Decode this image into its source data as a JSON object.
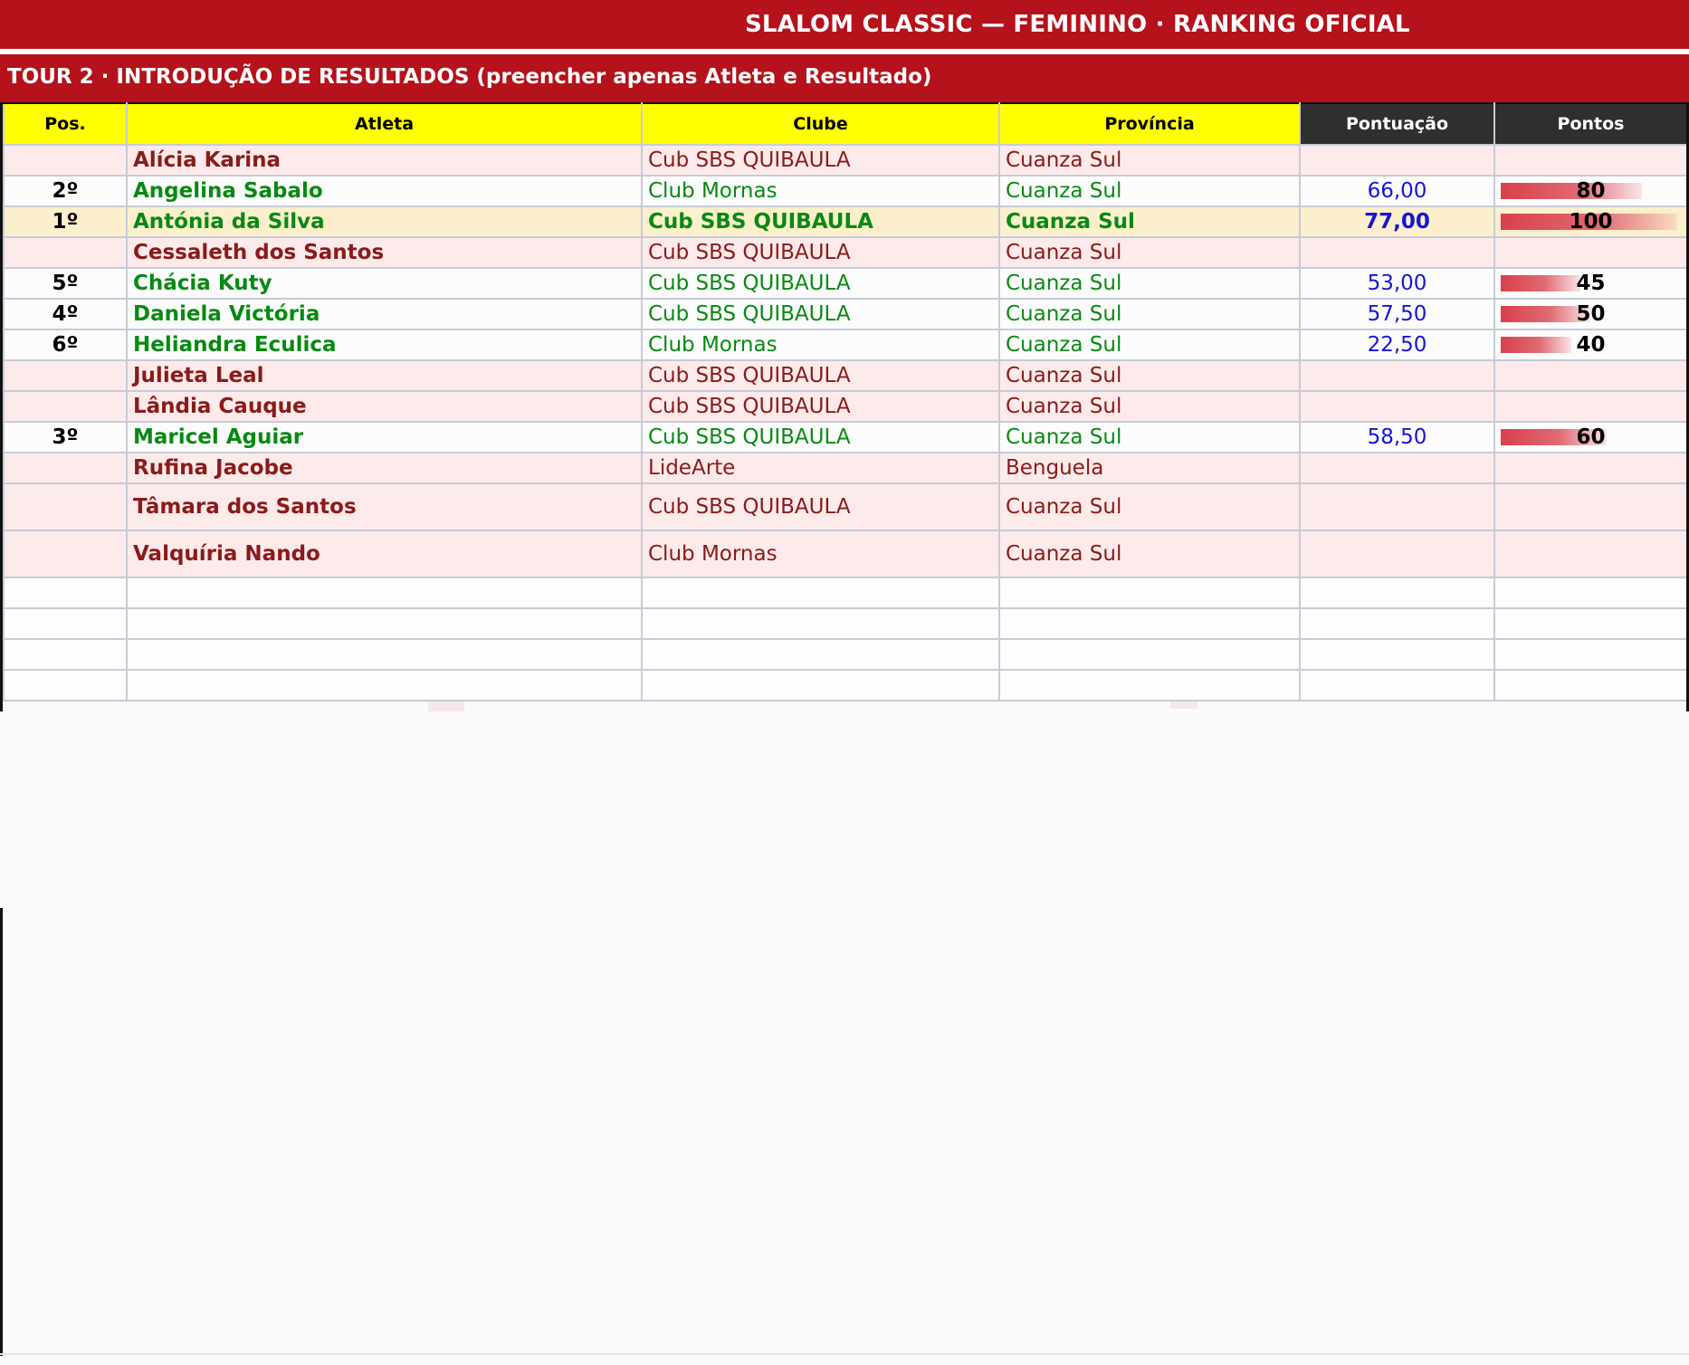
{
  "header": {
    "title": "SLALOM CLASSIC — FEMININO  ·  RANKING OFICIAL",
    "subtitle": "TOUR 2  ·  INTRODUÇÃO DE RESULTADOS  (preencher apenas Atleta e Resultado)"
  },
  "columns": {
    "pos": "Pos.",
    "athlete": "Atleta",
    "club": "Clube",
    "province": "Província",
    "score": "Pontuação",
    "points": "Pontos"
  },
  "colors": {
    "brand_red": "#b5121b",
    "header_yellow": "#ffff00",
    "header_dark": "#2f2f2f",
    "ranked_green": "#078a12",
    "pending_red": "#8b1a1a",
    "score_blue": "#1515d6"
  },
  "rows": [
    {
      "pos": "",
      "athlete": "Alícia Karina",
      "club": "Cub SBS QUIBAULA",
      "province": "Cuanza Sul",
      "score": "",
      "points": "",
      "bar": 0,
      "state": "pending"
    },
    {
      "pos": "2º",
      "athlete": "Angelina Sabalo",
      "club": "Club Mornas",
      "province": "Cuanza Sul",
      "score": "66,00",
      "points": "80",
      "bar": 0.8,
      "state": "ranked"
    },
    {
      "pos": "1º",
      "athlete": "Antónia da Silva",
      "club": "Cub SBS QUIBAULA",
      "province": "Cuanza Sul",
      "score": "77,00",
      "points": "100",
      "bar": 1.0,
      "state": "leader"
    },
    {
      "pos": "",
      "athlete": "Cessaleth dos Santos",
      "club": "Cub SBS QUIBAULA",
      "province": "Cuanza Sul",
      "score": "",
      "points": "",
      "bar": 0,
      "state": "pending"
    },
    {
      "pos": "5º",
      "athlete": "Chácia Kuty",
      "club": "Cub SBS QUIBAULA",
      "province": "Cuanza Sul",
      "score": "53,00",
      "points": "45",
      "bar": 0.45,
      "state": "ranked"
    },
    {
      "pos": "4º",
      "athlete": "Daniela Victória",
      "club": "Cub SBS QUIBAULA",
      "province": "Cuanza Sul",
      "score": "57,50",
      "points": "50",
      "bar": 0.5,
      "state": "ranked"
    },
    {
      "pos": "6º",
      "athlete": "Heliandra Eculica",
      "club": "Club Mornas",
      "province": "Cuanza Sul",
      "score": "22,50",
      "points": "40",
      "bar": 0.4,
      "state": "ranked"
    },
    {
      "pos": "",
      "athlete": "Julieta Leal",
      "club": "Cub SBS QUIBAULA",
      "province": "Cuanza Sul",
      "score": "",
      "points": "",
      "bar": 0,
      "state": "pending"
    },
    {
      "pos": "",
      "athlete": "Lândia Cauque",
      "club": "Cub SBS QUIBAULA",
      "province": "Cuanza Sul",
      "score": "",
      "points": "",
      "bar": 0,
      "state": "pending"
    },
    {
      "pos": "3º",
      "athlete": "Maricel Aguiar",
      "club": "Cub SBS QUIBAULA",
      "province": "Cuanza Sul",
      "score": "58,50",
      "points": "60",
      "bar": 0.6,
      "state": "ranked"
    },
    {
      "pos": "",
      "athlete": "Rufina Jacobe",
      "club": "LideArte",
      "province": "Benguela",
      "score": "",
      "points": "",
      "bar": 0,
      "state": "pending"
    },
    {
      "pos": "",
      "athlete": "Tâmara dos Santos",
      "club": "Cub SBS QUIBAULA",
      "province": "Cuanza Sul",
      "score": "",
      "points": "",
      "bar": 0,
      "state": "pending",
      "tall": true
    },
    {
      "pos": "",
      "athlete": "Valquíria Nando",
      "club": "Club Mornas",
      "province": "Cuanza Sul",
      "score": "",
      "points": "",
      "bar": 0,
      "state": "pending",
      "tall": true
    }
  ],
  "blank_rows": 4
}
